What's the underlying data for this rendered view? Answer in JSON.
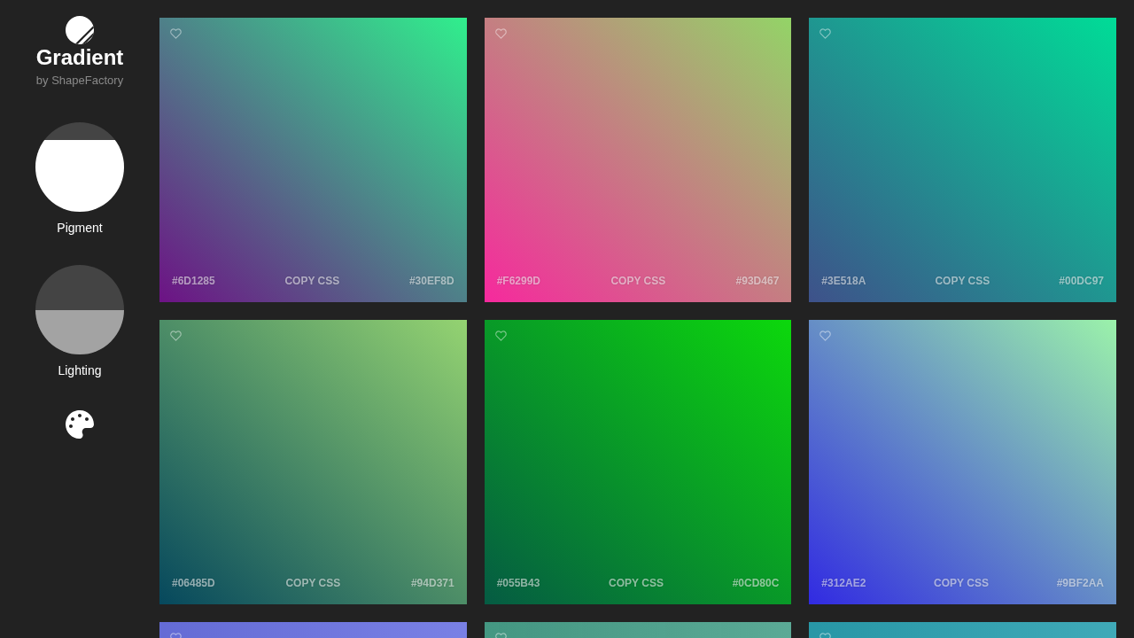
{
  "app": {
    "name": "Gradient",
    "byline": "by ShapeFactory"
  },
  "controls": [
    {
      "label": "Pigment",
      "level": 0.8,
      "color": "#ffffff"
    },
    {
      "label": "Lighting",
      "level": 0.5,
      "color": "#a3a3a3"
    }
  ],
  "cards": [
    {
      "start": "#6D1285",
      "end": "#30EF8D",
      "action": "COPY CSS",
      "favorite": false
    },
    {
      "start": "#F6299D",
      "end": "#93D467",
      "action": "COPY CSS",
      "favorite": false
    },
    {
      "start": "#3E518A",
      "end": "#00DC97",
      "action": "COPY CSS",
      "favorite": false
    },
    {
      "start": "#06485D",
      "end": "#94D371",
      "action": "COPY CSS",
      "favorite": false
    },
    {
      "start": "#055B43",
      "end": "#0CD80C",
      "action": "COPY CSS",
      "favorite": false
    },
    {
      "start": "#312AE2",
      "end": "#9BF2AA",
      "action": "COPY CSS",
      "favorite": false
    },
    {
      "color": "#6a72e2",
      "favorite": false
    },
    {
      "color": "#48a08a",
      "favorite": false
    },
    {
      "color": "#2aa0b0",
      "favorite": false
    }
  ]
}
